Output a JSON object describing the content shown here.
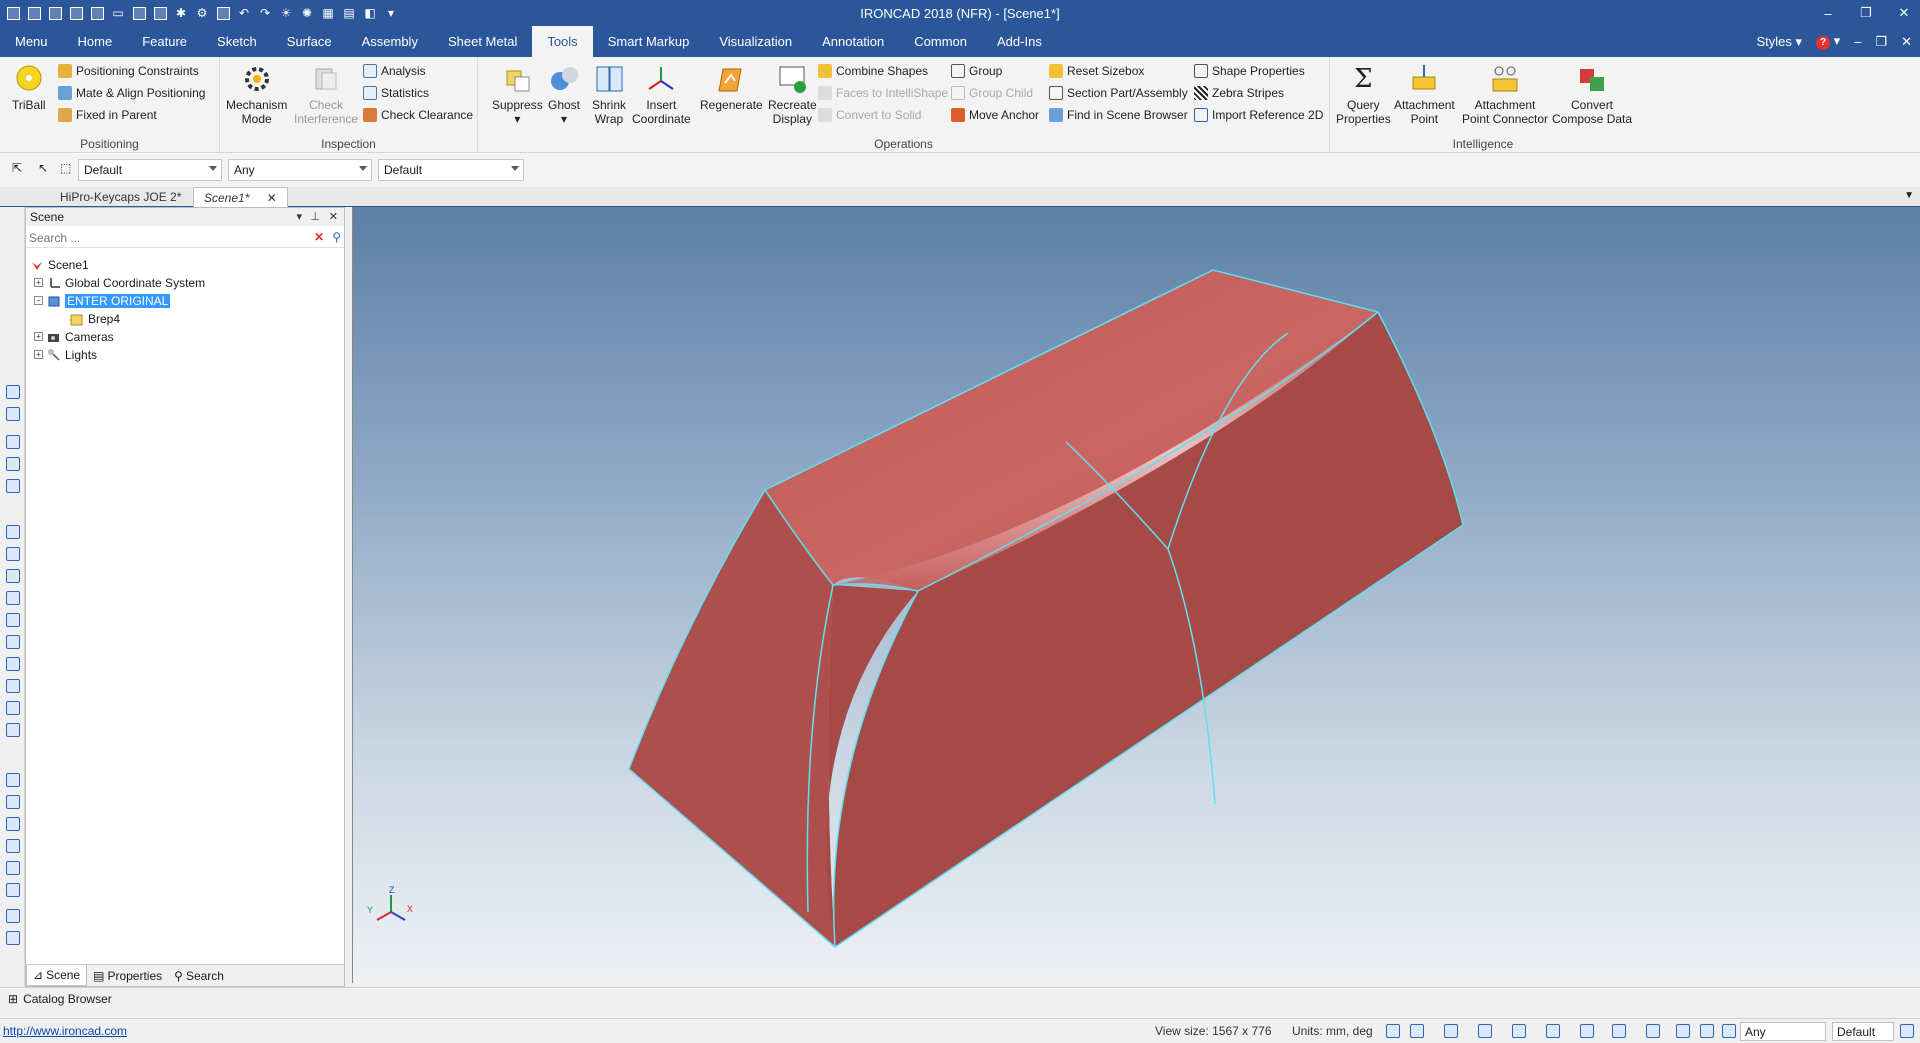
{
  "window": {
    "title": "IRONCAD 2018 (NFR) - [Scene1*]",
    "controls": [
      "–",
      "❐",
      "✕"
    ]
  },
  "ribbon": {
    "tabs": [
      "Menu",
      "Home",
      "Feature",
      "Sketch",
      "Surface",
      "Assembly",
      "Sheet Metal",
      "Tools",
      "Smart Markup",
      "Visualization",
      "Annotation",
      "Common",
      "Add-Ins"
    ],
    "active_tab": "Tools",
    "styles_label": "Styles",
    "groups": {
      "positioning": {
        "label": "Positioning",
        "triball": "TriBall",
        "positioning_constraints": "Positioning Constraints",
        "mate_align": "Mate & Align Positioning",
        "fixed_in_parent": "Fixed in Parent"
      },
      "inspection": {
        "label": "Inspection",
        "mechanism_mode": [
          "Mechanism",
          "Mode"
        ],
        "check_interference": [
          "Check",
          "Interference"
        ],
        "analysis": "Analysis",
        "statistics": "Statistics",
        "check_clearance": "Check Clearance"
      },
      "operations": {
        "label": "Operations",
        "suppress": "Suppress",
        "ghost": "Ghost",
        "shrink_wrap": [
          "Shrink",
          "Wrap"
        ],
        "insert_coordinate": [
          "Insert",
          "Coordinate"
        ],
        "regenerate": "Regenerate",
        "recreate_display": [
          "Recreate",
          "Display"
        ],
        "combine_shapes": "Combine Shapes",
        "faces_to_intellishape": "Faces to IntelliShape",
        "convert_to_solid": "Convert to Solid",
        "group": "Group",
        "group_child": "Group Child",
        "move_anchor": "Move Anchor",
        "reset_sizebox": "Reset Sizebox",
        "section_part": "Section Part/Assembly",
        "find_in_scene": "Find in Scene Browser",
        "shape_properties": "Shape Properties",
        "zebra_stripes": "Zebra Stripes",
        "import_reference": "Import Reference 2D"
      },
      "intelligence": {
        "label": "Intelligence",
        "query_properties": [
          "Query",
          "Properties"
        ],
        "attachment_point": [
          "Attachment",
          "Point"
        ],
        "attachment_point_connector": [
          "Attachment",
          "Point Connector"
        ],
        "convert_compose": [
          "Convert",
          "Compose Data"
        ]
      }
    }
  },
  "selector_bar": {
    "combo1": "Default",
    "combo2": "Any",
    "combo3": "Default"
  },
  "doc_tabs": [
    "HiPro-Keycaps JOE 2*",
    "Scene1*"
  ],
  "scene_panel": {
    "title": "Scene",
    "search_placeholder": "Search ...",
    "tree": [
      {
        "label": "Scene1"
      },
      {
        "label": "Global Coordinate System"
      },
      {
        "label": "ENTER ORIGINAL"
      },
      {
        "label": "Brep4"
      },
      {
        "label": "Cameras"
      },
      {
        "label": "Lights"
      }
    ],
    "bottom_tabs": [
      "Scene",
      "Properties",
      "Search"
    ]
  },
  "viewport": {
    "axis_labels": {
      "z": "Z",
      "x": "X",
      "y": "Y"
    },
    "colors": {
      "face": "#b65856",
      "edge": "#5fe0f0",
      "highlight": "#f7d4d3"
    }
  },
  "catalog_browser": "Catalog Browser",
  "status_bar": {
    "link": "http://www.ironcad.com",
    "view_size": "View size: 1567 x  776",
    "units": "Units: mm, deg",
    "combo_any": "Any",
    "combo_default": "Default"
  }
}
